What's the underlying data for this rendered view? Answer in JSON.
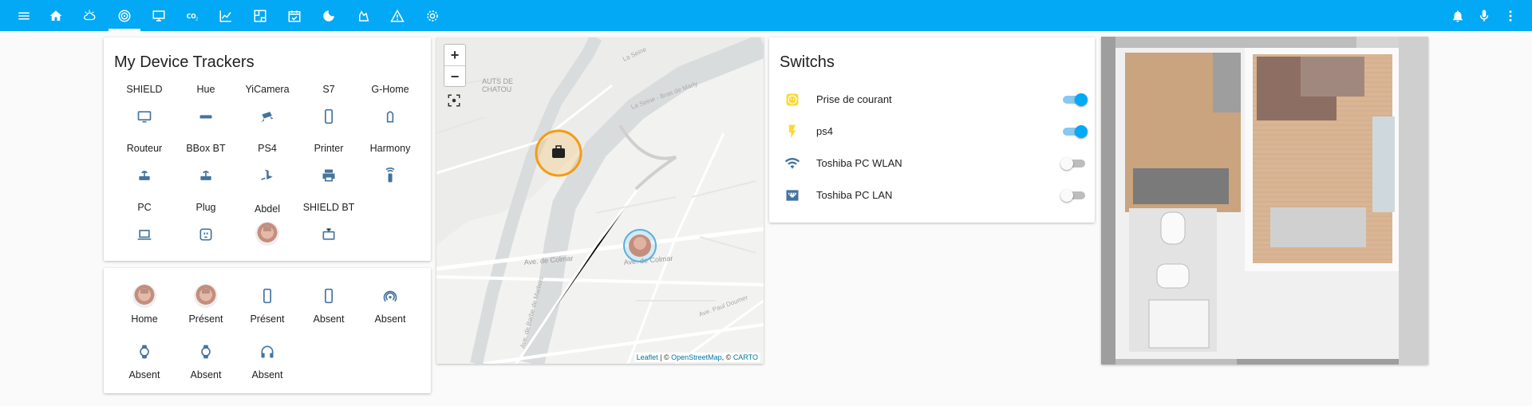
{
  "topbar": {
    "icons": [
      "menu-icon",
      "home-icon",
      "weather-icon",
      "radar-icon",
      "monitor-icon",
      "co2-icon",
      "chart-line-icon",
      "floor-plan-icon",
      "calendar-check-icon",
      "moon-icon",
      "chess-icon",
      "alert-icon",
      "settings-icon"
    ],
    "right_icons": [
      "bell-icon",
      "microphone-icon",
      "more-vert-icon"
    ]
  },
  "trackers": {
    "title": "My Device Trackers",
    "items": [
      {
        "name": "SHIELD",
        "icon": "tv-icon"
      },
      {
        "name": "Hue",
        "icon": "bridge-icon"
      },
      {
        "name": "YiCamera",
        "icon": "cctv-icon"
      },
      {
        "name": "S7",
        "icon": "cellphone-icon"
      },
      {
        "name": "G-Home",
        "icon": "google-home-icon"
      },
      {
        "name": "Routeur",
        "icon": "router-icon"
      },
      {
        "name": "BBox BT",
        "icon": "router-icon"
      },
      {
        "name": "PS4",
        "icon": "playstation-icon"
      },
      {
        "name": "Printer",
        "icon": "printer-icon"
      },
      {
        "name": "Harmony",
        "icon": "remote-icon"
      },
      {
        "name": "PC",
        "icon": "laptop-icon"
      },
      {
        "name": "Plug",
        "icon": "power-socket-icon"
      },
      {
        "name": "Abdel",
        "icon": "avatar"
      },
      {
        "name": "SHIELD BT",
        "icon": "tv-classic-icon"
      }
    ]
  },
  "presence": {
    "items": [
      {
        "state": "Home",
        "icon": "avatar"
      },
      {
        "state": "Présent",
        "icon": "avatar"
      },
      {
        "state": "Présent",
        "icon": "cellphone-icon"
      },
      {
        "state": "Absent",
        "icon": "cellphone-icon"
      },
      {
        "state": "Absent",
        "icon": "access-point-icon"
      },
      {
        "state": "Absent",
        "icon": "watch-icon"
      },
      {
        "state": "Absent",
        "icon": "watch-icon"
      },
      {
        "state": "Absent",
        "icon": "headphones-icon"
      }
    ]
  },
  "map": {
    "zoom_in": "+",
    "zoom_out": "−",
    "labels": {
      "chatou_1": "AUTS DE",
      "chatou_2": "CHATOU",
      "seine_1": "La Seine",
      "seine_2": "La Seine - Bras de Marly",
      "colmar_1": "Ave. de Colmar",
      "colmar_2": "Ave. de Colmar",
      "doumer": "Ave. Paul Doumer",
      "barbe": "Ave. de Barbe de Marbois"
    },
    "attribution": {
      "leaflet": "Leaflet",
      "sep1": " | © ",
      "osm": "OpenStreetMap",
      "sep2": ", © ",
      "carto": "CARTO"
    }
  },
  "switches": {
    "title": "Switchs",
    "items": [
      {
        "label": "Prise de courant",
        "icon": "power-socket-icon",
        "on": true,
        "icon_color": "#fdd835"
      },
      {
        "label": "ps4",
        "icon": "flash-icon",
        "on": true,
        "icon_color": "#fdd835"
      },
      {
        "label": "Toshiba PC WLAN",
        "icon": "wifi-icon",
        "on": false,
        "icon_color": "#44739e"
      },
      {
        "label": "Toshiba PC LAN",
        "icon": "ethernet-icon",
        "on": false,
        "icon_color": "#44739e"
      }
    ]
  },
  "colors": {
    "primary": "#03a9f4",
    "icon": "#44739e",
    "active_icon": "#fdd835"
  }
}
